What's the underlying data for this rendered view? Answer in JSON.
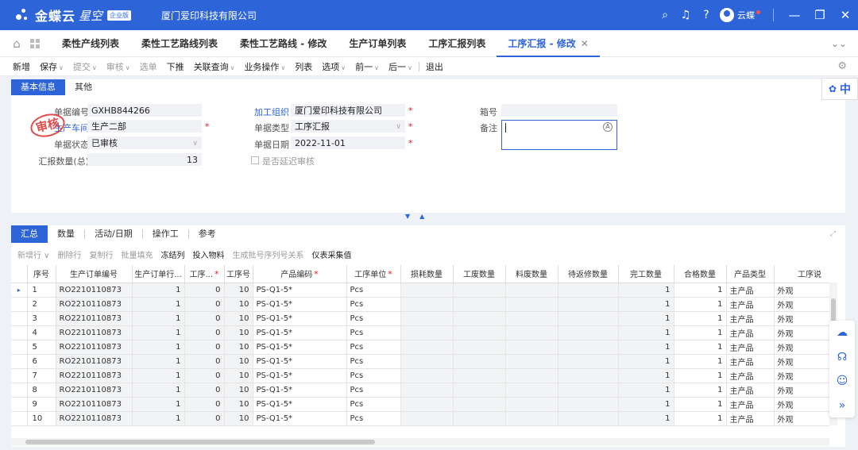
{
  "brand": {
    "name": "金蝶云",
    "product": "星空",
    "edition": "企业版",
    "company": "厦门爱印科技有限公司"
  },
  "titlebar": {
    "username": "云蝶",
    "icons": [
      "search-icon",
      "bell-icon",
      "help-icon"
    ]
  },
  "tabs": [
    {
      "label": "柔性产线列表"
    },
    {
      "label": "柔性工艺路线列表"
    },
    {
      "label": "柔性工艺路线 - 修改"
    },
    {
      "label": "生产订单列表"
    },
    {
      "label": "工序汇报列表"
    },
    {
      "label": "工序汇报 - 修改",
      "active": true
    }
  ],
  "toolbar": {
    "new": "新增",
    "save": "保存",
    "submit": "提交",
    "audit": "审核",
    "select": "选单",
    "push": "下推",
    "related": "关联查询",
    "business": "业务操作",
    "list": "列表",
    "options": "选项",
    "prev": "前一",
    "next": "后一",
    "exit": "退出"
  },
  "header_tabs": [
    "基本信息",
    "其他"
  ],
  "form": {
    "bill_no_label": "单据编号",
    "bill_no": "GXHB844266",
    "workshop_label": "生产车间",
    "workshop": "生产二部",
    "status_label": "单据状态",
    "status": "已审核",
    "qty_label": "汇报数量(总)",
    "qty": "13",
    "org_label": "加工组织",
    "org": "厦门爱印科技有限公司",
    "bill_type_label": "单据类型",
    "bill_type": "工序汇报",
    "bill_date_label": "单据日期",
    "bill_date": "2022-11-01",
    "delay_label": "是否延迟审核",
    "box_label": "箱号",
    "box": "",
    "remark_label": "备注",
    "remark": ""
  },
  "stamp_text": "审核",
  "language": "中",
  "entry_tabs": [
    "汇总",
    "数量",
    "活动/日期",
    "操作工",
    "参考"
  ],
  "entry_toolbar": [
    "新增行",
    "删除行",
    "复制行",
    "批量填充",
    "冻结列",
    "投入物料",
    "生成批号序列号关系",
    "仪表采集值"
  ],
  "grid": {
    "columns": [
      "序号",
      "生产订单编号",
      "生产订单行...",
      "工序...",
      "工序号",
      "产品编码",
      "工序单位",
      "损耗数量",
      "工废数量",
      "料废数量",
      "待返修数量",
      "完工数量",
      "合格数量",
      "产品类型",
      "工序说"
    ],
    "required": [
      false,
      false,
      false,
      true,
      false,
      true,
      true,
      false,
      false,
      false,
      false,
      false,
      false,
      false,
      false
    ],
    "rows": [
      [
        "1",
        "RO2210110873",
        "1",
        "0",
        "10",
        "PS-Q1-5*",
        "Pcs",
        "",
        "",
        "",
        "",
        "1",
        "1",
        "主产品",
        "外观"
      ],
      [
        "2",
        "RO2210110873",
        "1",
        "0",
        "10",
        "PS-Q1-5*",
        "Pcs",
        "",
        "",
        "",
        "",
        "1",
        "1",
        "主产品",
        "外观"
      ],
      [
        "3",
        "RO2210110873",
        "1",
        "0",
        "10",
        "PS-Q1-5*",
        "Pcs",
        "",
        "",
        "",
        "",
        "1",
        "1",
        "主产品",
        "外观"
      ],
      [
        "4",
        "RO2210110873",
        "1",
        "0",
        "10",
        "PS-Q1-5*",
        "Pcs",
        "",
        "",
        "",
        "",
        "1",
        "1",
        "主产品",
        "外观"
      ],
      [
        "5",
        "RO2210110873",
        "1",
        "0",
        "10",
        "PS-Q1-5*",
        "Pcs",
        "",
        "",
        "",
        "",
        "1",
        "1",
        "主产品",
        "外观"
      ],
      [
        "6",
        "RO2210110873",
        "1",
        "0",
        "10",
        "PS-Q1-5*",
        "Pcs",
        "",
        "",
        "",
        "",
        "1",
        "1",
        "主产品",
        "外观"
      ],
      [
        "7",
        "RO2210110873",
        "1",
        "0",
        "10",
        "PS-Q1-5*",
        "Pcs",
        "",
        "",
        "",
        "",
        "1",
        "1",
        "主产品",
        "外观"
      ],
      [
        "8",
        "RO2210110873",
        "1",
        "0",
        "10",
        "PS-Q1-5*",
        "Pcs",
        "",
        "",
        "",
        "",
        "1",
        "1",
        "主产品",
        "外观"
      ],
      [
        "9",
        "RO2210110873",
        "1",
        "0",
        "10",
        "PS-Q1-5*",
        "Pcs",
        "",
        "",
        "",
        "",
        "1",
        "1",
        "主产品",
        "外观"
      ],
      [
        "10",
        "RO2210110873",
        "1",
        "0",
        "10",
        "PS-Q1-5*",
        "Pcs",
        "",
        "",
        "",
        "",
        "1",
        "1",
        "主产品",
        "外观"
      ]
    ]
  },
  "colors": {
    "accent": "#2d64d8",
    "required": "#e02020",
    "stamp": "#d9302c"
  }
}
